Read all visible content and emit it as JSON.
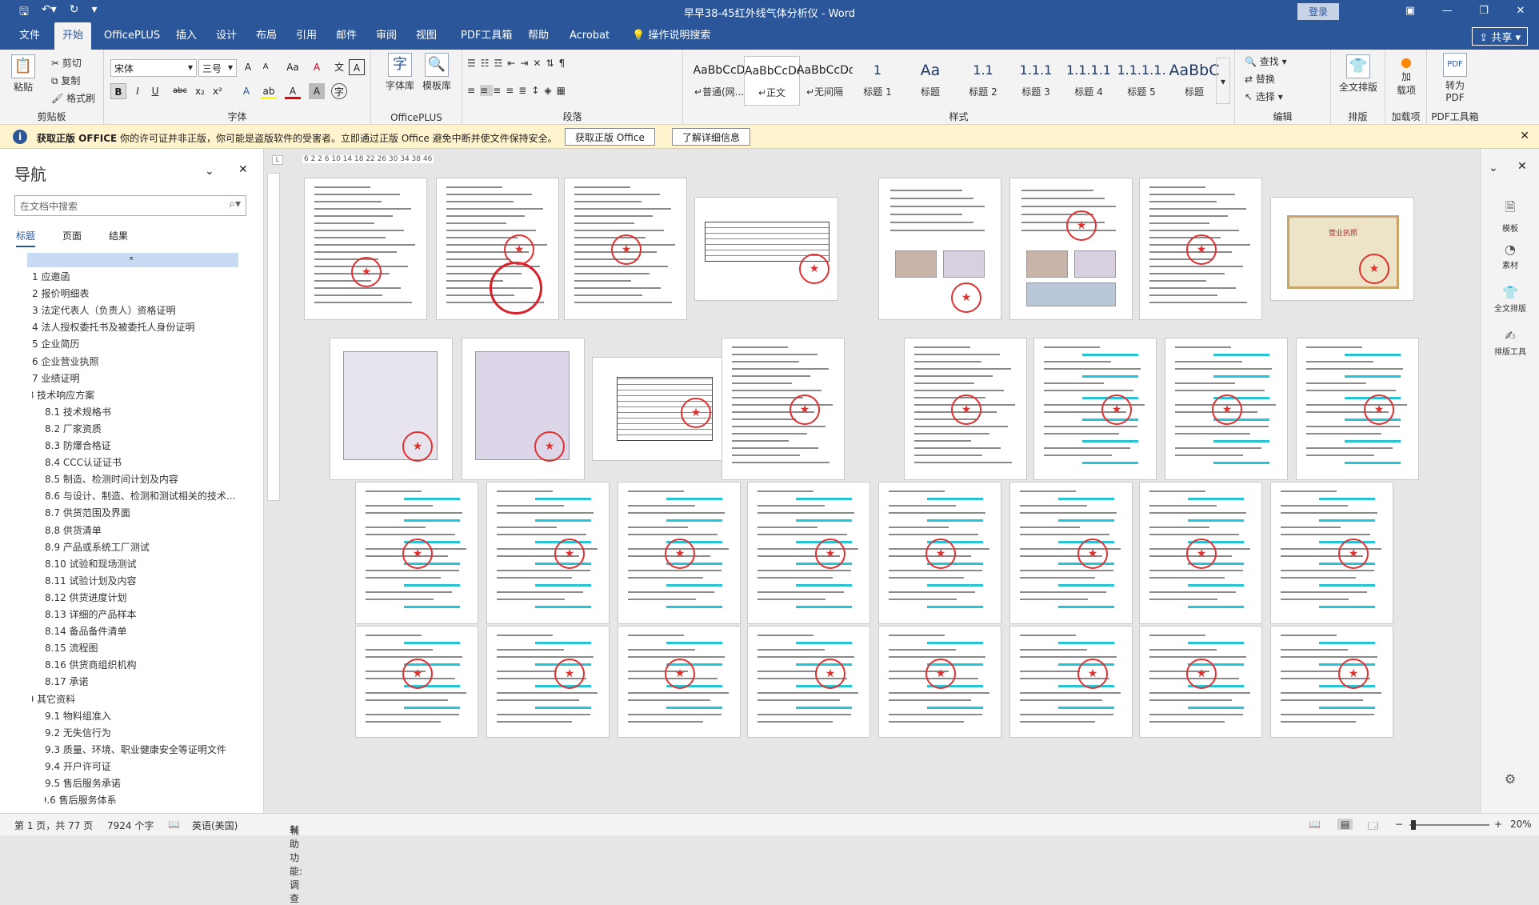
{
  "titlebar": {
    "title": "早早38-45红外线气体分析仪  -  Word",
    "login": "登录",
    "save_icon": "save-icon",
    "undo_icon": "undo-icon",
    "redo_icon": "redo-icon"
  },
  "tabs": [
    "文件",
    "开始",
    "OfficePLUS",
    "插入",
    "设计",
    "布局",
    "引用",
    "邮件",
    "审阅",
    "视图",
    "PDF工具箱",
    "帮助",
    "Acrobat",
    "操作说明搜索"
  ],
  "share": "共享",
  "ribbon": {
    "clipboard": {
      "label": "剪贴板",
      "paste": "粘贴",
      "cut": "剪切",
      "copy": "复制",
      "format_painter": "格式刷"
    },
    "font": {
      "label": "字体",
      "font_name": "宋体",
      "font_size": "三号",
      "bold": "B",
      "italic": "I",
      "underline": "U",
      "strike": "abc",
      "sub": "x₂",
      "sup": "x²",
      "grow": "A",
      "shrink": "A",
      "case": "Aa",
      "clear": "A",
      "effects": "A",
      "highlight": "ab",
      "color": "A",
      "charshade": "A",
      "phonetic": "文",
      "border": "A"
    },
    "officeplus": {
      "label": "OfficePLUS",
      "zk": "字体库",
      "mb": "模板库"
    },
    "paragraph": {
      "label": "段落"
    },
    "styles": {
      "label": "样式",
      "items": [
        {
          "sample": "AaBbCcD",
          "name": "↵普通(网..."
        },
        {
          "sample": "AaBbCcDd",
          "name": "↵正文"
        },
        {
          "sample": "AaBbCcDd",
          "name": "↵无间隔"
        },
        {
          "sample": "1",
          "name": "标题 1"
        },
        {
          "sample": "Aa",
          "name": "标题"
        },
        {
          "sample": "1.1",
          "name": "标题 2"
        },
        {
          "sample": "1.1.1",
          "name": "标题 3"
        },
        {
          "sample": "1.1.1.1",
          "name": "标题 4"
        },
        {
          "sample": "1.1.1.1.",
          "name": "标题 5"
        },
        {
          "sample": "AaBbC",
          "name": "标题"
        }
      ]
    },
    "editing": {
      "label": "编辑",
      "find": "查找",
      "replace": "替换",
      "select": "选择"
    },
    "layout": {
      "label": "排版",
      "full": "全文排版"
    },
    "addin": {
      "label": "加载项",
      "text": "加\n载项"
    },
    "pdf": {
      "label": "PDF工具箱",
      "text": "转为\nPDF"
    }
  },
  "notice": {
    "title": "获取正版 OFFICE",
    "message": "你的许可证并非正版，你可能是盗版软件的受害者。立即通过正版 Office 避免中断并使文件保持安全。",
    "btn1": "获取正版 Office",
    "btn2": "了解详细信息"
  },
  "nav": {
    "title": "导航",
    "search_placeholder": "在文档中搜索",
    "tabs": [
      "标题",
      "页面",
      "结果"
    ],
    "items": [
      {
        "t": "1 应邀函",
        "lvl": 1
      },
      {
        "t": "2 报价明细表",
        "lvl": 1
      },
      {
        "t": "3 法定代表人（负责人）资格证明",
        "lvl": 1
      },
      {
        "t": "4 法人授权委托书及被委托人身份证明",
        "lvl": 1
      },
      {
        "t": "5 企业简历",
        "lvl": 1
      },
      {
        "t": "6 企业营业执照",
        "lvl": 1
      },
      {
        "t": "7 业绩证明",
        "lvl": 1
      },
      {
        "t": "8 技术响应方案",
        "lvl": 1,
        "exp": true
      },
      {
        "t": "8.1 技术规格书",
        "lvl": 2
      },
      {
        "t": "8.2 厂家资质",
        "lvl": 2
      },
      {
        "t": "8.3 防爆合格证",
        "lvl": 2
      },
      {
        "t": "8.4 CCC认证证书",
        "lvl": 2
      },
      {
        "t": "8.5 制造、检测时间计划及内容",
        "lvl": 2
      },
      {
        "t": "8.6 与设计、制造、检测和测试相关的技术...",
        "lvl": 2
      },
      {
        "t": "8.7 供货范围及界面",
        "lvl": 2
      },
      {
        "t": "8.8 供货清单",
        "lvl": 2
      },
      {
        "t": "8.9 产品或系统工厂测试",
        "lvl": 2
      },
      {
        "t": "8.10 试验和现场测试",
        "lvl": 2
      },
      {
        "t": "8.11 试验计划及内容",
        "lvl": 2
      },
      {
        "t": "8.12 供货进度计划",
        "lvl": 2
      },
      {
        "t": "8.13 详细的产品样本",
        "lvl": 2
      },
      {
        "t": "8.14 备品备件清单",
        "lvl": 2
      },
      {
        "t": "8.15 流程图",
        "lvl": 2
      },
      {
        "t": "8.16 供货商组织机构",
        "lvl": 2
      },
      {
        "t": "8.17 承诺",
        "lvl": 2
      },
      {
        "t": "9 其它资料",
        "lvl": 1,
        "exp": true
      },
      {
        "t": "9.1 物料组准入",
        "lvl": 2
      },
      {
        "t": "9.2 无失信行为",
        "lvl": 2
      },
      {
        "t": "9.3 质量、环境、职业健康安全等证明文件",
        "lvl": 2
      },
      {
        "t": "9.4 开户许可证",
        "lvl": 2
      },
      {
        "t": "9.5 售后服务承诺",
        "lvl": 2
      },
      {
        "t": "9.6 售后服务体系",
        "lvl": 2,
        "exp": true
      }
    ]
  },
  "canvas": {
    "ruler_text": "6  2 2  6 10 14 18 22 26 30 34 38  46",
    "page_title": "营业执照"
  },
  "right_pane": [
    "模板",
    "素材",
    "全文排版",
    "排版工具"
  ],
  "status": {
    "page": "第 1 页，共 77 页",
    "words": "7924 个字",
    "lang": "英语(美国)",
    "accessibility": "辅助功能: 调查",
    "zoom": "20%"
  }
}
